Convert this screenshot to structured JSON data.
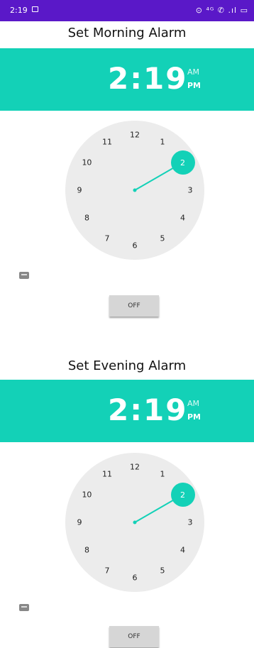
{
  "status_bar": {
    "time": "2:19",
    "right_text": "⊙ ⁴ᴳ ✆ .ıl ▭"
  },
  "morning": {
    "title": "Set Morning Alarm",
    "time_display": "2:19",
    "am_label": "AM",
    "pm_label": "PM",
    "selected_hour": "2",
    "toggle_label": "OFF"
  },
  "evening": {
    "title": "Set Evening Alarm",
    "time_display": "2:19",
    "am_label": "AM",
    "pm_label": "PM",
    "selected_hour": "2",
    "toggle_label": "OFF"
  },
  "clock_numbers": [
    "12",
    "1",
    "2",
    "3",
    "4",
    "5",
    "6",
    "7",
    "8",
    "9",
    "10",
    "11"
  ],
  "colors": {
    "accent": "#13d1b7",
    "status_bar": "#5a18c8",
    "dial": "#ececec"
  },
  "icons": {
    "keyboard": "keyboard-icon"
  }
}
